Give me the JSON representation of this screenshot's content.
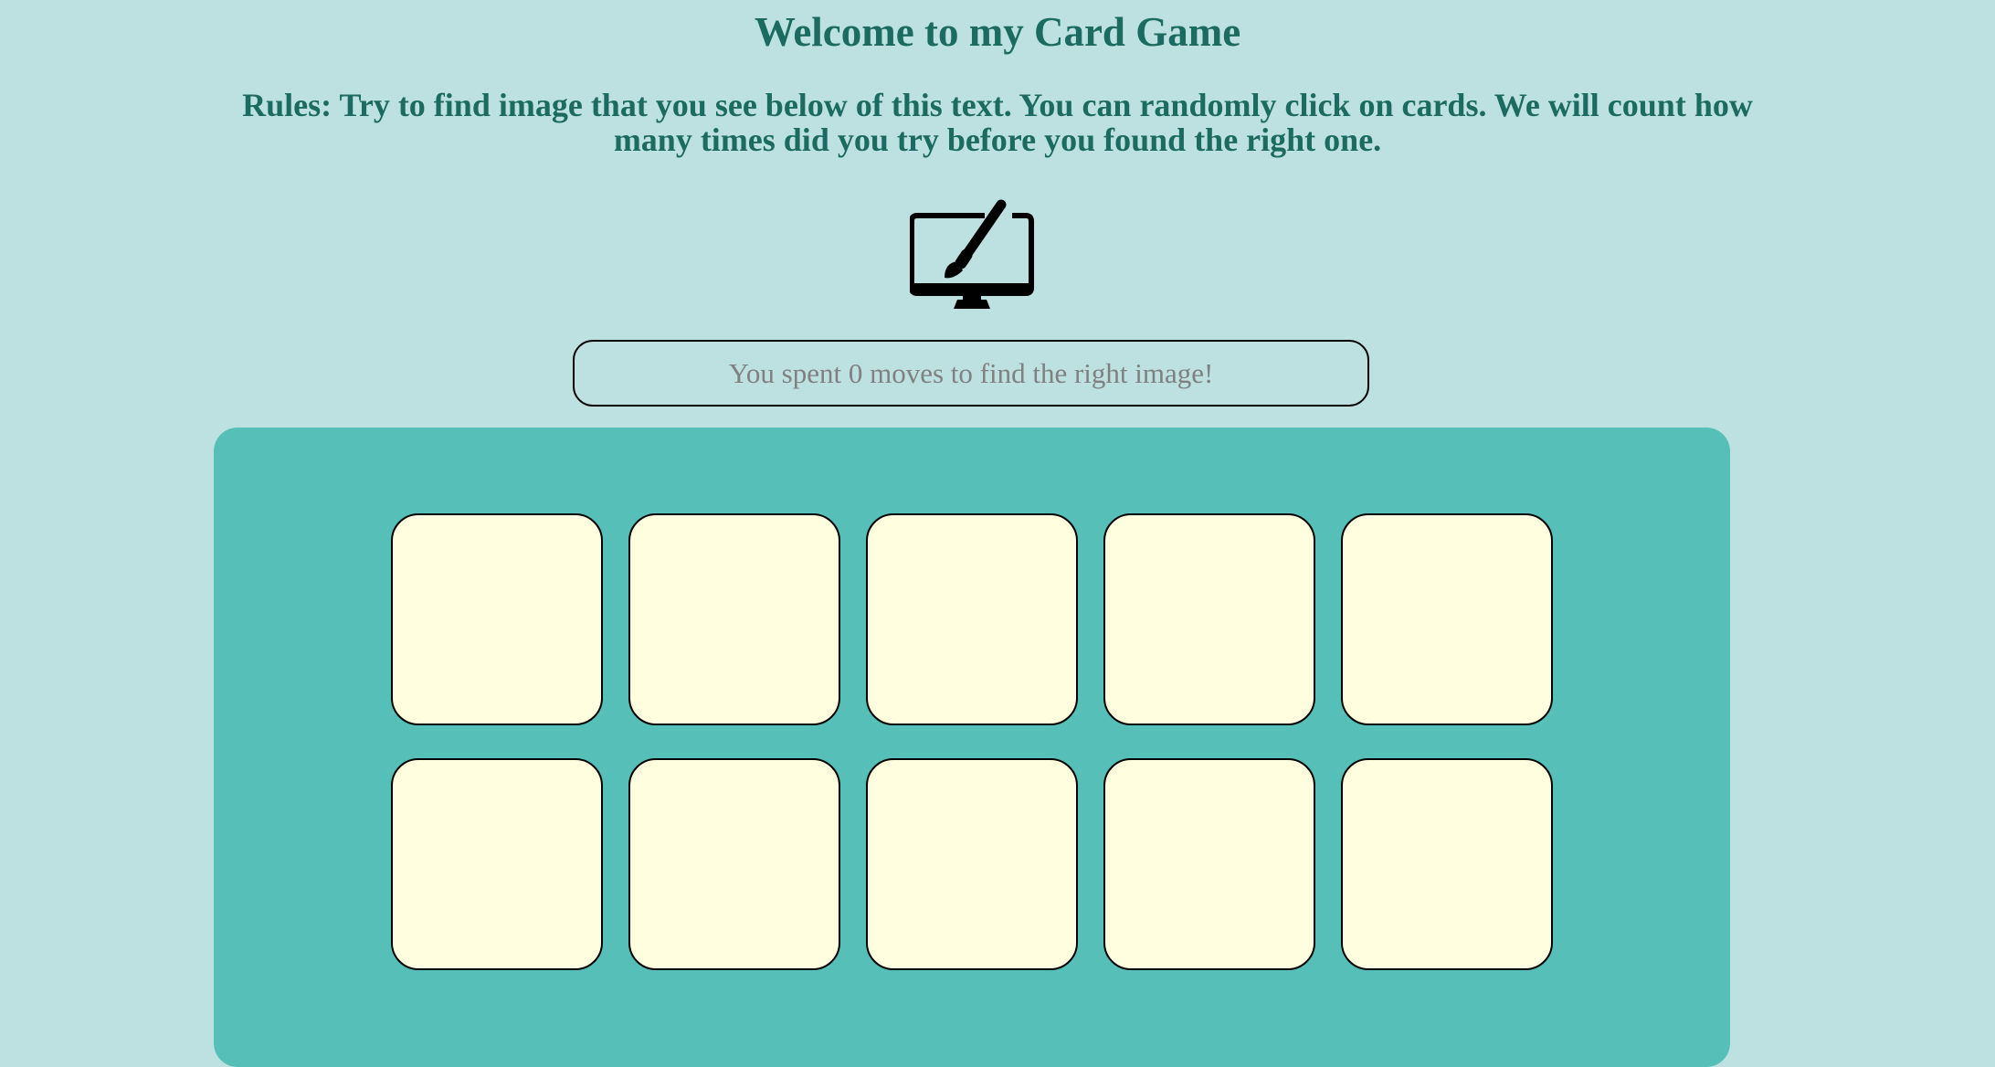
{
  "header": {
    "title": "Welcome to my Card Game",
    "rules": "Rules: Try to find image that you see below of this text. You can randomly click on cards. We will count how many times did you try before you found the right one."
  },
  "target": {
    "icon": "monitor-paintbrush-icon"
  },
  "status": {
    "moves_text": "You spent 0 moves to find the right image!"
  },
  "board": {
    "rows": 2,
    "columns": 5,
    "cards": [
      {
        "state": "face-down"
      },
      {
        "state": "face-down"
      },
      {
        "state": "face-down"
      },
      {
        "state": "face-down"
      },
      {
        "state": "face-down"
      },
      {
        "state": "face-down"
      },
      {
        "state": "face-down"
      },
      {
        "state": "face-down"
      },
      {
        "state": "face-down"
      },
      {
        "state": "face-down"
      }
    ]
  },
  "colors": {
    "background": "#bde1e0",
    "heading": "#1c6b60",
    "board": "#55bfb8",
    "card": "#ffffe0",
    "status_text": "#808080"
  }
}
